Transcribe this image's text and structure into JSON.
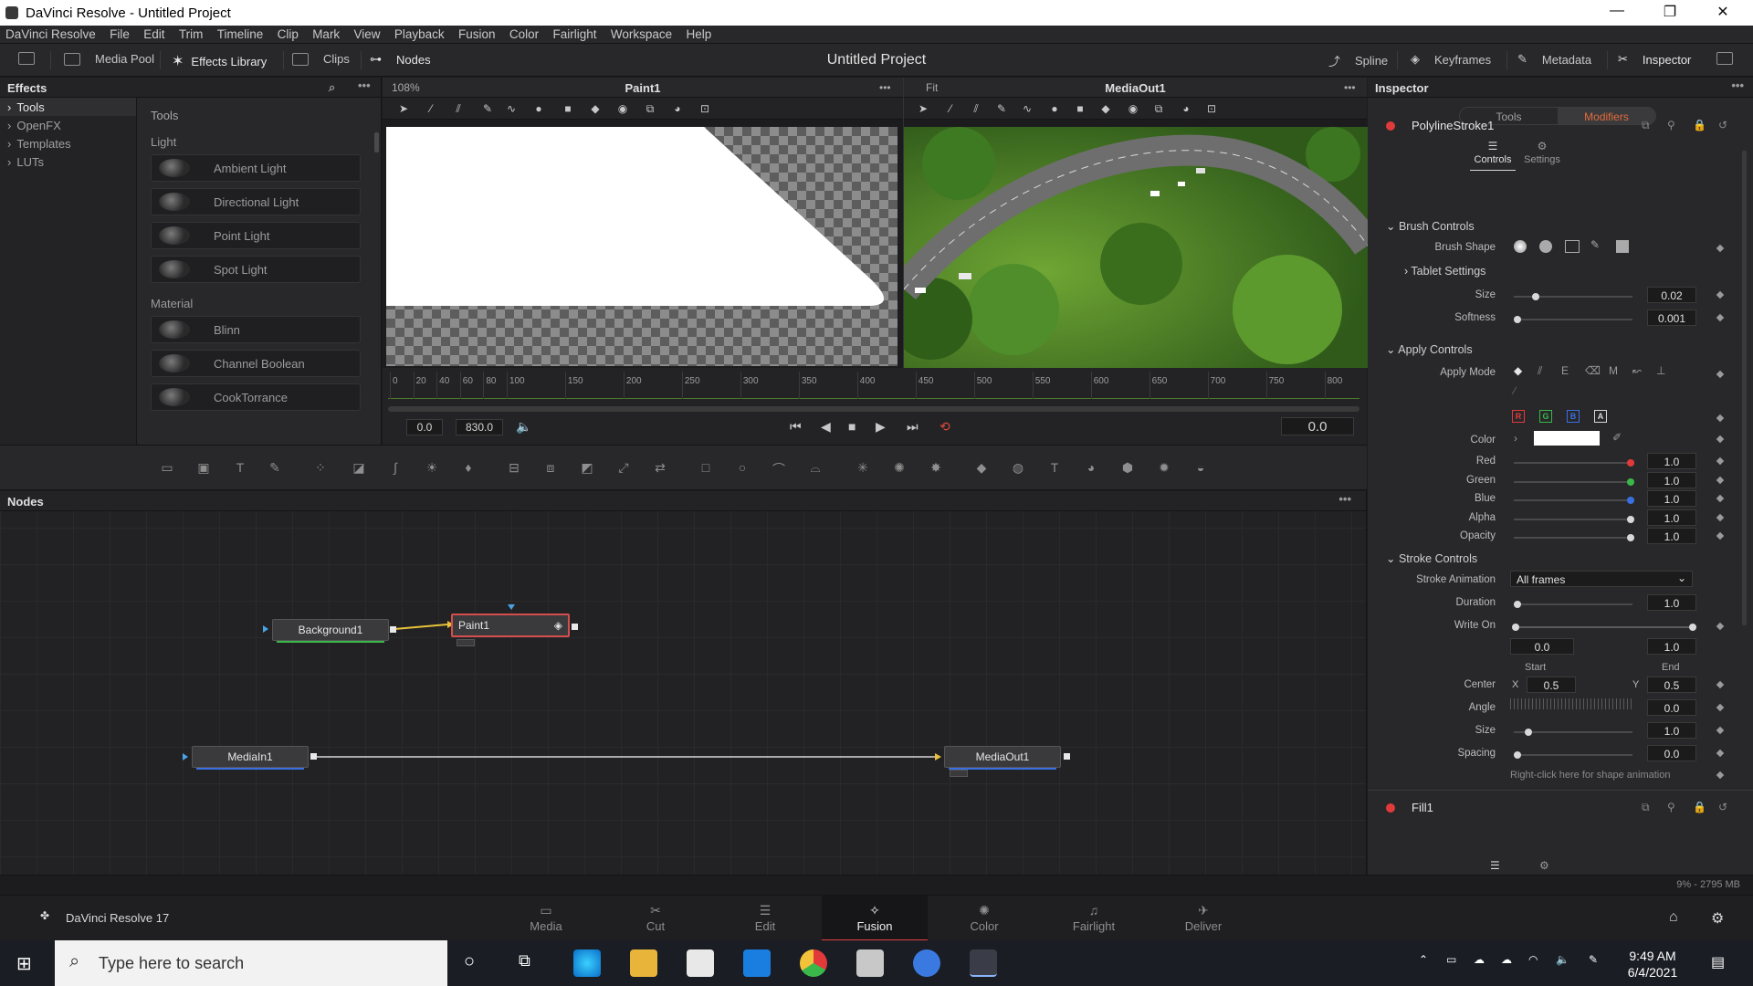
{
  "window": {
    "title": "DaVinci Resolve - Untitled Project"
  },
  "menu": [
    "DaVinci Resolve",
    "File",
    "Edit",
    "Trim",
    "Timeline",
    "Clip",
    "Mark",
    "View",
    "Playback",
    "Fusion",
    "Color",
    "Fairlight",
    "Workspace",
    "Help"
  ],
  "toolbar": {
    "media_pool": "Media Pool",
    "effects_library": "Effects Library",
    "clips": "Clips",
    "nodes": "Nodes",
    "project_title": "Untitled Project",
    "spline": "Spline",
    "keyframes": "Keyframes",
    "metadata": "Metadata",
    "inspector": "Inspector"
  },
  "effects": {
    "header": "Effects",
    "tree": [
      "Tools",
      "OpenFX",
      "Templates",
      "LUTs"
    ],
    "list_title": "Tools",
    "sections": [
      {
        "name": "Light",
        "items": [
          "Ambient Light",
          "Directional Light",
          "Point Light",
          "Spot Light"
        ]
      },
      {
        "name": "Material",
        "items": [
          "Blinn",
          "Channel Boolean",
          "CookTorrance"
        ]
      }
    ]
  },
  "viewer_left": {
    "zoom": "108%",
    "title": "Paint1"
  },
  "viewer_right": {
    "zoom": "Fit",
    "title": "MediaOut1"
  },
  "ruler": {
    "ticks": [
      "0",
      "20",
      "40",
      "60",
      "80",
      "100",
      "150",
      "200",
      "250",
      "300",
      "350",
      "400",
      "450",
      "500",
      "550",
      "600",
      "650",
      "700",
      "750",
      "800"
    ]
  },
  "transport": {
    "start": "0.0",
    "end": "830.0",
    "current": "0.0"
  },
  "nodes": {
    "header": "Nodes",
    "items": [
      {
        "name": "Background1"
      },
      {
        "name": "Paint1"
      },
      {
        "name": "MediaIn1"
      },
      {
        "name": "MediaOut1"
      }
    ]
  },
  "inspector": {
    "header": "Inspector",
    "tabs": [
      "Tools",
      "Modifiers"
    ],
    "tool_name": "PolylineStroke1",
    "subtabs": [
      "Controls",
      "Settings"
    ],
    "brush_controls": "Brush Controls",
    "brush_shape": "Brush Shape",
    "tablet_settings": "Tablet Settings",
    "size_label": "Size",
    "size_val": "0.02",
    "softness_label": "Softness",
    "softness_val": "0.001",
    "apply_controls": "Apply Controls",
    "apply_mode": "Apply Mode",
    "channels": [
      "R",
      "G",
      "B",
      "A"
    ],
    "color_label": "Color",
    "rgba": [
      {
        "label": "Red",
        "val": "1.0",
        "color": "#e23a3a"
      },
      {
        "label": "Green",
        "val": "1.0",
        "color": "#3ab84a"
      },
      {
        "label": "Blue",
        "val": "1.0",
        "color": "#3a6fe2"
      },
      {
        "label": "Alpha",
        "val": "1.0",
        "color": "#d8d8d8"
      },
      {
        "label": "Opacity",
        "val": "1.0",
        "color": "#d8d8d8"
      }
    ],
    "stroke_controls": "Stroke Controls",
    "stroke_animation_label": "Stroke Animation",
    "stroke_animation_val": "All frames",
    "duration_label": "Duration",
    "duration_val": "1.0",
    "write_on_label": "Write On",
    "write_on_start": "0.0",
    "write_on_end": "1.0",
    "start_label": "Start",
    "end_label": "End",
    "center_label": "Center",
    "center_x_label": "X",
    "center_x": "0.5",
    "center_y_label": "Y",
    "center_y": "0.5",
    "angle_label": "Angle",
    "angle_val": "0.0",
    "size2_label": "Size",
    "size2_val": "1.0",
    "spacing_label": "Spacing",
    "spacing_val": "0.0",
    "hint": "Right-click here for shape animation",
    "fill_name": "Fill1"
  },
  "status": {
    "memory": "9% - 2795 MB"
  },
  "app_name": "DaVinci Resolve 17",
  "pages": [
    {
      "label": "Media",
      "icon": "media-icon"
    },
    {
      "label": "Cut",
      "icon": "cut-icon"
    },
    {
      "label": "Edit",
      "icon": "edit-icon"
    },
    {
      "label": "Fusion",
      "icon": "fusion-icon"
    },
    {
      "label": "Color",
      "icon": "color-icon"
    },
    {
      "label": "Fairlight",
      "icon": "fairlight-icon"
    },
    {
      "label": "Deliver",
      "icon": "deliver-icon"
    }
  ],
  "taskbar": {
    "search_placeholder": "Type here to search",
    "time": "9:49 AM",
    "date": "6/4/2021"
  }
}
